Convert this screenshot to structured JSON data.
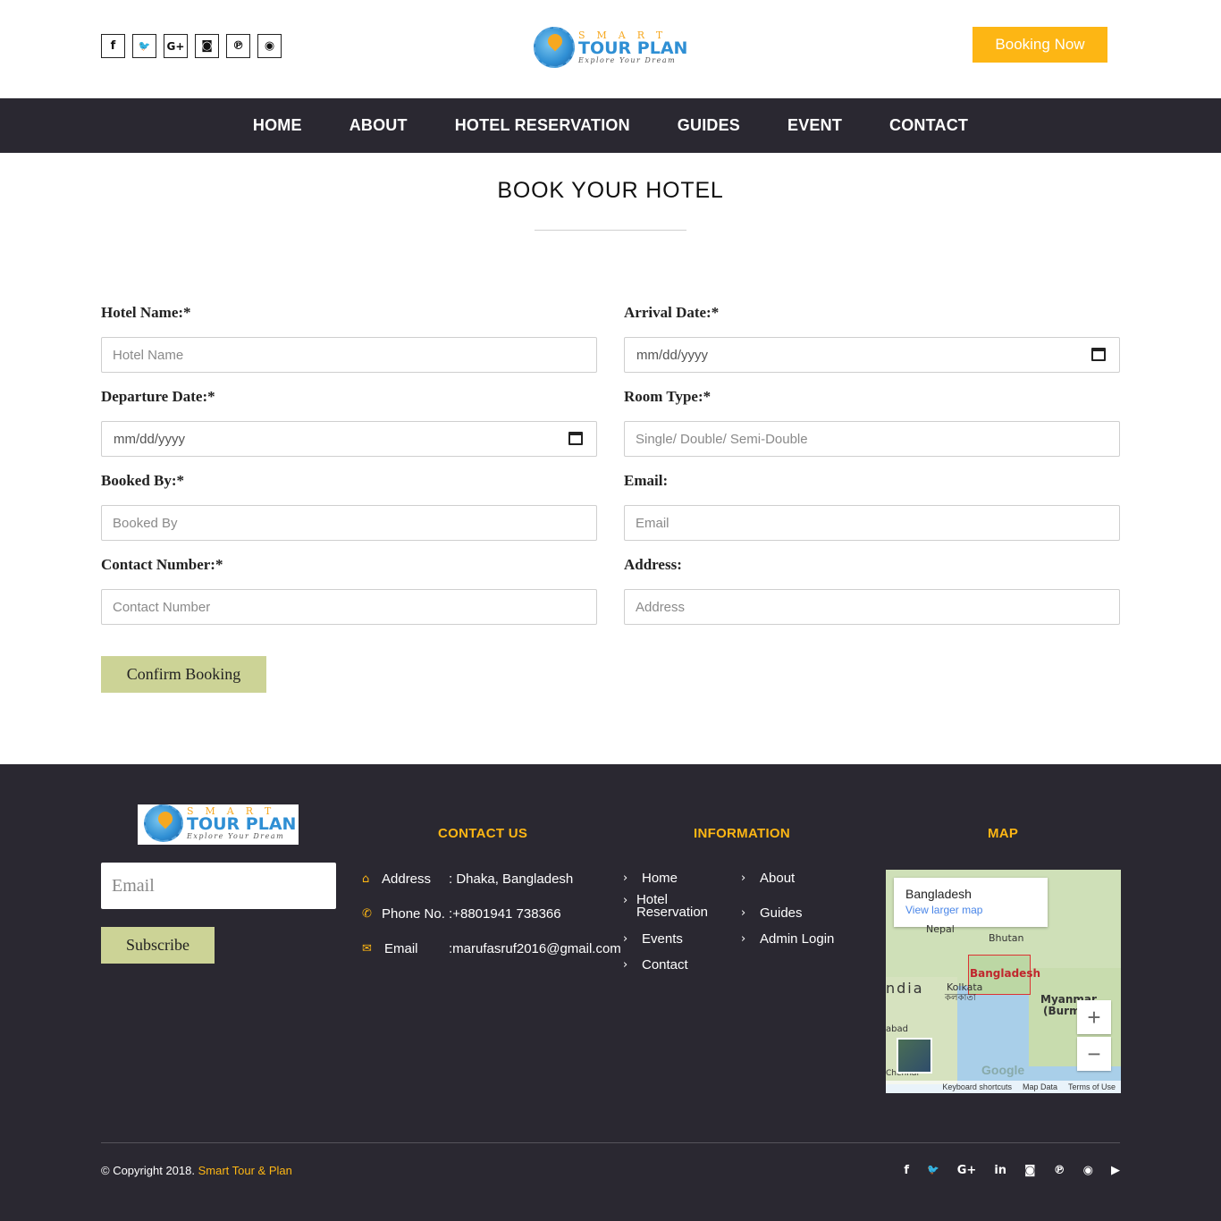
{
  "header": {
    "social": [
      {
        "icon": "facebook-icon",
        "glyph": "f"
      },
      {
        "icon": "twitter-icon",
        "glyph": "🐦"
      },
      {
        "icon": "google-plus-icon",
        "glyph": "G+"
      },
      {
        "icon": "instagram-icon",
        "glyph": "◙"
      },
      {
        "icon": "pinterest-icon",
        "glyph": "℗"
      },
      {
        "icon": "aperture-icon",
        "glyph": "◉"
      }
    ],
    "logo": {
      "smart": "SMART",
      "main": "TOUR PLAN",
      "tagline": "Explore Your Dream"
    },
    "booking_button": "Booking Now"
  },
  "nav": {
    "items": [
      "HOME",
      "ABOUT",
      "HOTEL RESERVATION",
      "GUIDES",
      "EVENT",
      "CONTACT"
    ]
  },
  "page": {
    "title": "BOOK YOUR HOTEL"
  },
  "form": {
    "hotel_name": {
      "label": "Hotel Name:*",
      "placeholder": "Hotel Name"
    },
    "arrival_date": {
      "label": "Arrival Date:*",
      "value": "mm/dd/yyyy"
    },
    "departure_date": {
      "label": "Departure Date:*",
      "value": "mm/dd/yyyy"
    },
    "room_type": {
      "label": "Room Type:*",
      "placeholder": "Single/ Double/ Semi-Double"
    },
    "booked_by": {
      "label": "Booked By:*",
      "placeholder": "Booked By"
    },
    "email": {
      "label": "Email:",
      "placeholder": "Email"
    },
    "contact_number": {
      "label": "Contact Number:*",
      "placeholder": "Contact Number"
    },
    "address": {
      "label": "Address:",
      "placeholder": "Address"
    },
    "submit": "Confirm Booking"
  },
  "footer": {
    "subscribe": {
      "placeholder": "Email",
      "button": "Subscribe"
    },
    "contact": {
      "heading": "CONTACT US",
      "address": {
        "label": "Address",
        "value": ": Dhaka, Bangladesh"
      },
      "phone": {
        "label": "Phone No. :",
        "value": "+8801941 738366"
      },
      "email": {
        "label": "Email",
        "value": ":marufasruf2016@gmail.com"
      }
    },
    "information": {
      "heading": "INFORMATION",
      "col1": [
        "Home",
        "Hotel Reservation",
        "Events",
        "Contact"
      ],
      "col2": [
        "About",
        "Guides",
        "Admin Login"
      ]
    },
    "map": {
      "heading": "MAP",
      "place": "Bangladesh",
      "link": "View larger map",
      "labels": {
        "nepal": "Nepal",
        "bhutan": "Bhutan",
        "bangladesh": "Bangladesh",
        "kolkata": "Kolkata",
        "kolkata_local": "কলকাতা",
        "india": "ndia",
        "myanmar": "Myanmar",
        "burma": "(Burm",
        "chennai": "Chennai",
        "abad": "abad",
        "google": "Google"
      },
      "attribution": [
        "Keyboard shortcuts",
        "Map Data",
        "Terms of Use"
      ],
      "zoom_in": "+",
      "zoom_out": "−"
    },
    "copyright_prefix": "© Copyright 2018.",
    "copyright_brand": "Smart Tour & Plan",
    "social": [
      {
        "icon": "facebook-icon",
        "glyph": "f"
      },
      {
        "icon": "twitter-icon",
        "glyph": "🐦"
      },
      {
        "icon": "google-plus-icon",
        "glyph": "G+"
      },
      {
        "icon": "linkedin-icon",
        "glyph": "in"
      },
      {
        "icon": "instagram-icon",
        "glyph": "◙"
      },
      {
        "icon": "pinterest-icon",
        "glyph": "℗"
      },
      {
        "icon": "aperture-icon",
        "glyph": "◉"
      },
      {
        "icon": "youtube-icon",
        "glyph": "▶"
      }
    ]
  },
  "colors": {
    "accent": "#fdb614",
    "dark": "#2a2831",
    "button_olive": "#ccd396",
    "map_link": "#4a86e8"
  }
}
